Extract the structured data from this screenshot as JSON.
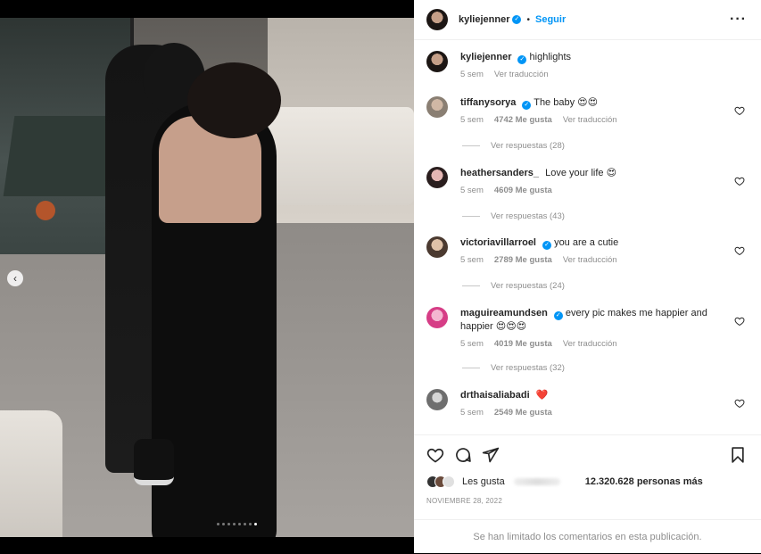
{
  "post": {
    "slide_count": 8,
    "active_slide": 8,
    "prev_label": "‹"
  },
  "header": {
    "username": "kyliejenner",
    "verified": true,
    "separator": "•",
    "follow_label": "Seguir",
    "more_label": "···"
  },
  "caption": {
    "username": "kyliejenner",
    "text": "highlights",
    "time": "5 sem",
    "translate": "Ver traducción"
  },
  "comments": [
    {
      "username": "tiffanysorya",
      "verified": true,
      "text": "The baby 😍😍",
      "time": "5 sem",
      "likes": "4742 Me gusta",
      "translate": "Ver traducción",
      "replies": "Ver respuestas (28)"
    },
    {
      "username": "heathersanders_",
      "verified": false,
      "text": "Love your life 😍",
      "time": "5 sem",
      "likes": "4609 Me gusta",
      "translate": "",
      "replies": "Ver respuestas (43)"
    },
    {
      "username": "victoriavillarroel",
      "verified": true,
      "text": "you are a cutie",
      "time": "5 sem",
      "likes": "2789 Me gusta",
      "translate": "Ver traducción",
      "replies": "Ver respuestas (24)"
    },
    {
      "username": "maguireamundsen",
      "verified": true,
      "text": "every pic makes me happier and happier 😍😍😍",
      "time": "5 sem",
      "likes": "4019 Me gusta",
      "translate": "Ver traducción",
      "replies": "Ver respuestas (32)"
    },
    {
      "username": "drthaisaliabadi",
      "verified": false,
      "text": "❤️",
      "time": "5 sem",
      "likes": "2549 Me gusta",
      "translate": "",
      "replies": ""
    }
  ],
  "footer": {
    "liked_by_prefix": "Les gusta",
    "likes_count": "12.320.628 personas más",
    "date": "NOVIEMBRE 28, 2022",
    "comments_limited": "Se han limitado los comentarios en esta publicación."
  },
  "colors": {
    "accent": "#0095f6",
    "muted": "#8e8e8e",
    "text": "#262626"
  },
  "icons": [
    "heart-icon",
    "comment-icon",
    "share-icon",
    "bookmark-icon",
    "verified-icon",
    "more-icon",
    "chevron-left-icon"
  ]
}
